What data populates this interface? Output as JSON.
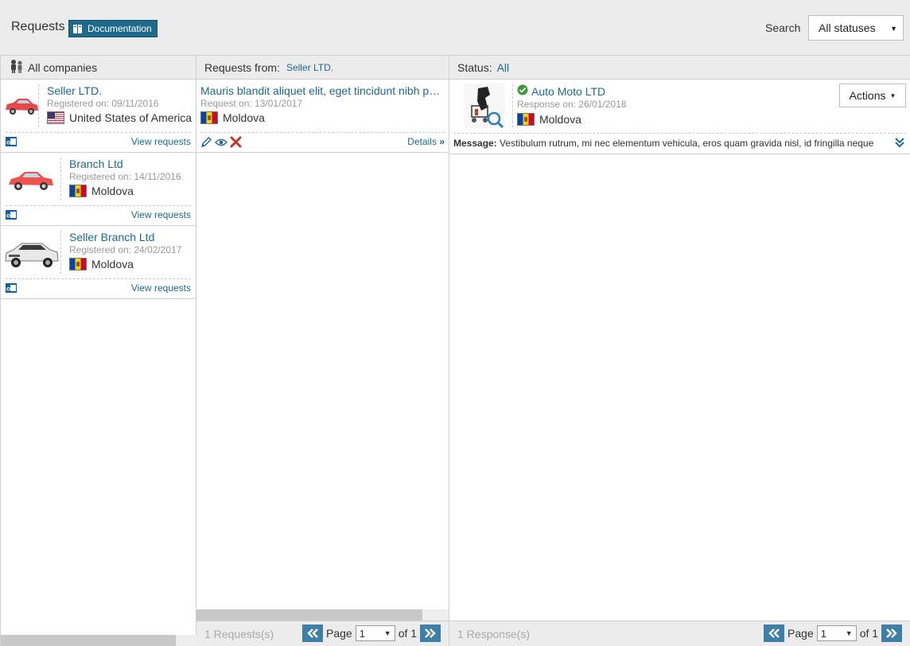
{
  "header": {
    "title": "Requests",
    "doc_button": "Documentation",
    "search_label": "Search",
    "status_select": "All statuses"
  },
  "companies": {
    "heading": "All companies",
    "items": [
      {
        "name": "Seller LTD.",
        "registered": "Registered on: 09/11/2016",
        "country": "United States of America",
        "link": "View requests"
      },
      {
        "name": "Branch Ltd",
        "registered": "Registered on: 14/11/2016",
        "country": "Moldova",
        "link": "View requests"
      },
      {
        "name": "Seller Branch Ltd",
        "registered": "Registered on: 24/02/2017",
        "country": "Moldova",
        "link": "View requests"
      }
    ]
  },
  "requests": {
    "heading": "Requests from:",
    "heading_company": "Seller LTD.",
    "items": [
      {
        "title": "Mauris blandit aliquet elit, eget tincidunt nibh pulvinar a",
        "date": "Request on: 13/01/2017",
        "country": "Moldova",
        "details": "Details"
      }
    ],
    "footer": {
      "count": "1 Requests(s)",
      "page_label": "Page",
      "page_value": "1",
      "of_label": "of 1"
    }
  },
  "responses": {
    "heading": "Status:",
    "heading_value": "All",
    "items": [
      {
        "name": "Auto Moto LTD",
        "date": "Response on: 26/01/2018",
        "country": "Moldova",
        "actions": "Actions",
        "message_label": "Message:",
        "message": "Vestibulum rutrum, mi nec elementum vehicula, eros quam gravida nisl, id fringilla neque"
      }
    ],
    "footer": {
      "count": "1 Response(s)",
      "page_label": "Page",
      "page_value": "1",
      "of_label": "of 1"
    }
  },
  "colors": {
    "accent": "#1e6a8d",
    "pager": "#3d7fa6",
    "header_bg": "#ececec"
  },
  "icons": [
    "book-icon",
    "people-icon",
    "outlook-icon",
    "edit-icon",
    "eye-icon",
    "delete-icon",
    "verified-icon",
    "chevron-double-down-icon",
    "chevron-double-left-icon",
    "chevron-double-right-icon"
  ]
}
